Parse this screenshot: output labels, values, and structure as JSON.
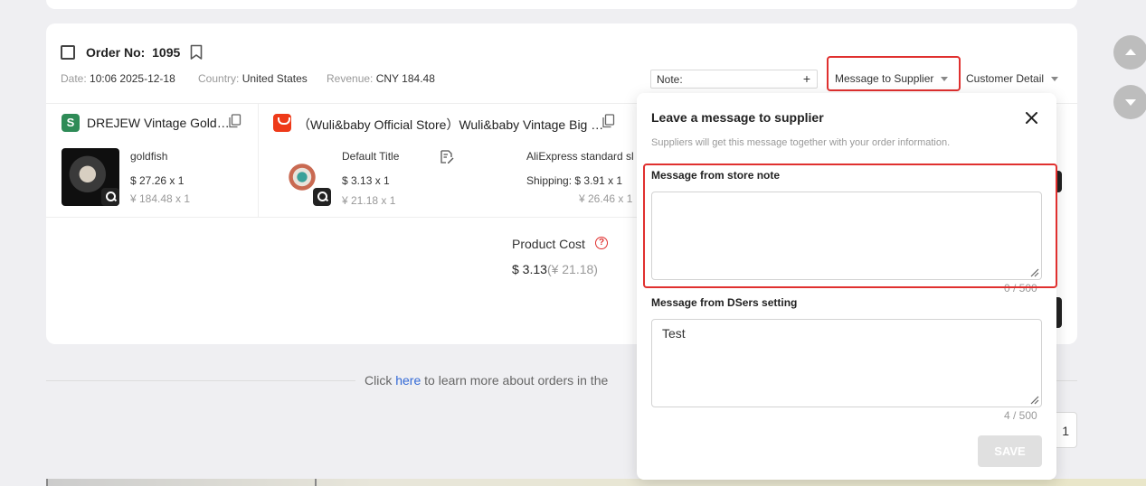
{
  "order": {
    "label": "Order No:",
    "number": "1095",
    "date_label": "Date:",
    "date": "10:06 2025-12-18",
    "country_label": "Country:",
    "country": "United States",
    "revenue_label": "Revenue:",
    "revenue": "CNY 184.48"
  },
  "toolbar": {
    "note_label": "Note:",
    "note_add": "+",
    "message_to_supplier": "Message to Supplier",
    "customer_detail": "Customer Detail"
  },
  "stores": [
    {
      "name": "DREJEW Vintage Gold…",
      "product": {
        "variant": "goldfish",
        "price": "$ 27.26 x 1",
        "price_cny": "¥ 184.48 x 1"
      }
    },
    {
      "name": "（Wuli&baby Official Store）Wuli&baby Vintage Big …",
      "product": {
        "variant": "Default Title",
        "price": "$ 3.13 x 1",
        "price_cny": "¥ 21.18 x 1",
        "shipping_method": "AliExpress standard sl",
        "shipping_label": "Shipping:",
        "shipping_price": "$ 3.91 x 1",
        "shipping_cny": "¥ 26.46 x 1"
      }
    }
  ],
  "cost": {
    "label": "Product Cost",
    "value": "$ 3.13",
    "value_cny": "(¥ 21.18)"
  },
  "footer": {
    "learn_prefix": "Click ",
    "learn_link": "here",
    "learn_suffix": " to learn more about orders in the",
    "page": "1"
  },
  "popover": {
    "title": "Leave a message to supplier",
    "description": "Suppliers will get this message together with your order information.",
    "store_note_label": "Message from store note",
    "store_note_value": "",
    "store_note_counter": "0 / 500",
    "dsers_label": "Message from DSers setting",
    "dsers_value": "Test",
    "dsers_counter": "4 / 500",
    "save_label": "SAVE"
  },
  "colors": {
    "highlight_red": "#e0302f",
    "link_blue": "#3369d6",
    "shopify_green": "#2e8b57",
    "aliexpress_orange": "#ee3a19"
  },
  "icons": [
    "bookmark-icon",
    "copy-icon",
    "zoom-icon",
    "edit-icon",
    "help-icon",
    "close-icon",
    "chevron-up-icon",
    "chevron-down-icon"
  ]
}
